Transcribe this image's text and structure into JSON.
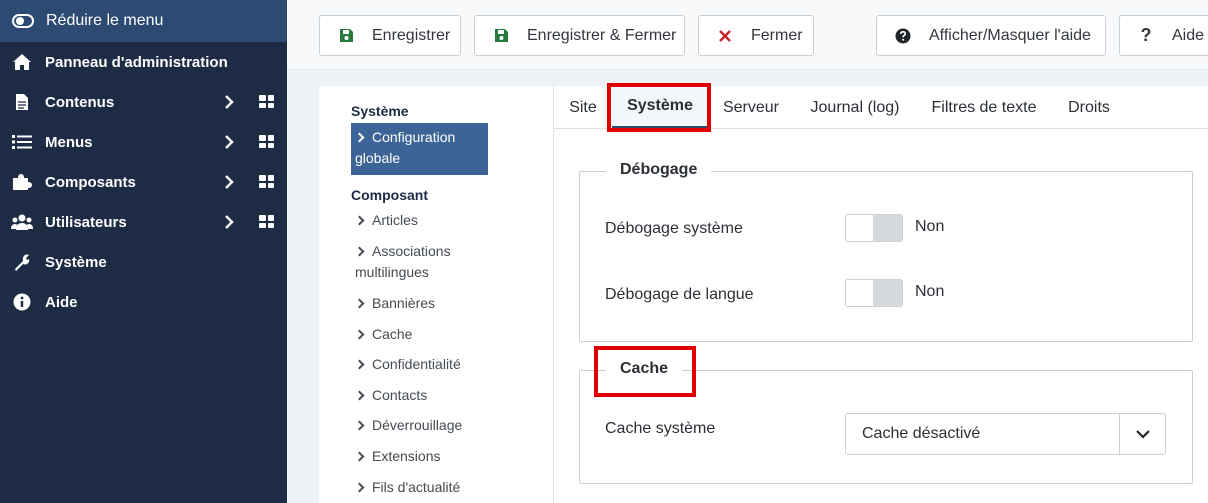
{
  "sidebar": {
    "toggle_label": "Réduire le menu",
    "items": [
      {
        "label": "Panneau d'administration",
        "icon": "home-icon"
      },
      {
        "label": "Contenus",
        "icon": "file-icon"
      },
      {
        "label": "Menus",
        "icon": "list-icon"
      },
      {
        "label": "Composants",
        "icon": "puzzle-icon"
      },
      {
        "label": "Utilisateurs",
        "icon": "users-icon"
      },
      {
        "label": "Système",
        "icon": "wrench-icon"
      },
      {
        "label": "Aide",
        "icon": "info-icon"
      }
    ]
  },
  "toolbar": {
    "save_label": "Enregistrer",
    "save_close_label": "Enregistrer & Fermer",
    "close_label": "Fermer",
    "toggle_help_label": "Afficher/Masquer l'aide",
    "help_label": "Aide"
  },
  "submenu": {
    "system_heading": "Système",
    "active_item_line1": "Configuration",
    "active_item_line2": "globale",
    "component_heading": "Composant",
    "items": [
      "Articles",
      "Associations",
      "multilingues",
      "Bannières",
      "Cache",
      "Confidentialité",
      "Contacts",
      "Déverrouillage",
      "Extensions",
      "Fils d'actualité"
    ]
  },
  "tabs": [
    "Site",
    "Système",
    "Serveur",
    "Journal (log)",
    "Filtres de texte",
    "Droits"
  ],
  "debug": {
    "legend": "Débogage",
    "system_debug_label": "Débogage système",
    "system_debug_value": "Non",
    "lang_debug_label": "Débogage de langue",
    "lang_debug_value": "Non"
  },
  "cache": {
    "legend": "Cache",
    "system_cache_label": "Cache système",
    "system_cache_value": "Cache désactivé"
  },
  "colors": {
    "sidebar_bg": "#1d2b45",
    "highlight": "#e00000"
  }
}
